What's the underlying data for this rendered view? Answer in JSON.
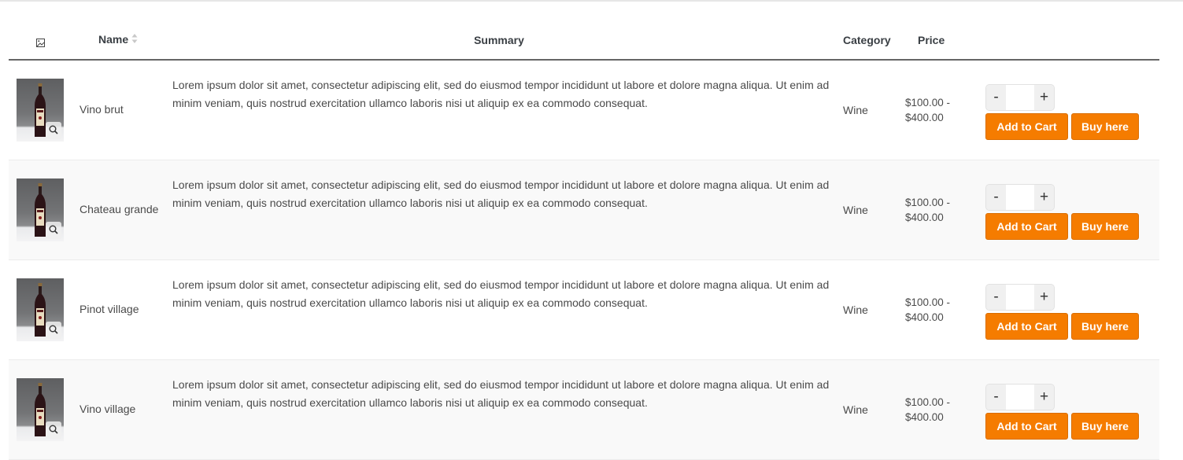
{
  "table": {
    "headers": {
      "image_icon": "image-icon",
      "name": "Name",
      "summary": "Summary",
      "category": "Category",
      "price": "Price"
    },
    "rows": [
      {
        "name": "Vino brut",
        "summary": "Lorem ipsum dolor sit amet, consectetur adipiscing elit, sed do eiusmod tempor incididunt ut labore et dolore magna aliqua. Ut enim ad minim veniam, quis nostrud exercitation ullamco laboris nisi ut aliquip ex ea commodo consequat.",
        "category": "Wine",
        "price_line1": "$100.00 -",
        "price_line2": "$400.00",
        "quantity": "",
        "minus_label": "-",
        "plus_label": "+",
        "add_to_cart_label": "Add to Cart",
        "buy_label": "Buy here"
      },
      {
        "name": "Chateau grande",
        "summary": "Lorem ipsum dolor sit amet, consectetur adipiscing elit, sed do eiusmod tempor incididunt ut labore et dolore magna aliqua. Ut enim ad minim veniam, quis nostrud exercitation ullamco laboris nisi ut aliquip ex ea commodo consequat.",
        "category": "Wine",
        "price_line1": "$100.00 -",
        "price_line2": "$400.00",
        "quantity": "",
        "minus_label": "-",
        "plus_label": "+",
        "add_to_cart_label": "Add to Cart",
        "buy_label": "Buy here"
      },
      {
        "name": "Pinot village",
        "summary": "Lorem ipsum dolor sit amet, consectetur adipiscing elit, sed do eiusmod tempor incididunt ut labore et dolore magna aliqua. Ut enim ad minim veniam, quis nostrud exercitation ullamco laboris nisi ut aliquip ex ea commodo consequat.",
        "category": "Wine",
        "price_line1": "$100.00 -",
        "price_line2": "$400.00",
        "quantity": "",
        "minus_label": "-",
        "plus_label": "+",
        "add_to_cart_label": "Add to Cart",
        "buy_label": "Buy here"
      },
      {
        "name": "Vino village",
        "summary": "Lorem ipsum dolor sit amet, consectetur adipiscing elit, sed do eiusmod tempor incididunt ut labore et dolore magna aliqua. Ut enim ad minim veniam, quis nostrud exercitation ullamco laboris nisi ut aliquip ex ea commodo consequat.",
        "category": "Wine",
        "price_line1": "$100.00 -",
        "price_line2": "$400.00",
        "quantity": "",
        "minus_label": "-",
        "plus_label": "+",
        "add_to_cart_label": "Add to Cart",
        "buy_label": "Buy here"
      }
    ]
  },
  "colors": {
    "accent": "#f57c00",
    "header_border": "#666666",
    "row_alt": "#f9f9f9"
  }
}
